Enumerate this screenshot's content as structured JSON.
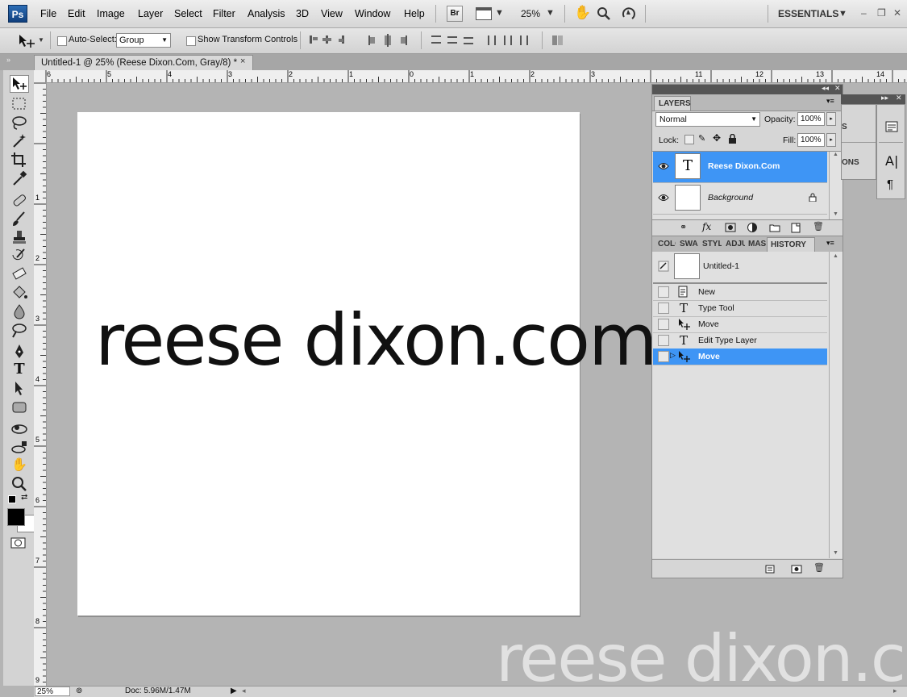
{
  "app": {
    "logo": "Ps"
  },
  "menus": [
    "File",
    "Edit",
    "Image",
    "Layer",
    "Select",
    "Filter",
    "Analysis",
    "3D",
    "View",
    "Window",
    "Help"
  ],
  "menubar": {
    "bridge_label": "Br",
    "zoom": "25%",
    "workspace": "ESSENTIALS"
  },
  "options": {
    "auto_select_label": "Auto-Select:",
    "auto_select_value": "Group",
    "transform_label": "Show Transform Controls"
  },
  "document": {
    "tab_title": "Untitled-1 @ 25% (Reese Dixon.Com, Gray/8) *",
    "close": "×"
  },
  "canvas": {
    "text": "reese dixon.com"
  },
  "watermark": {
    "text": "reese dixon.com"
  },
  "rulers": {
    "top": [
      "6",
      "5",
      "4",
      "3",
      "2",
      "1",
      "0",
      "1",
      "2",
      "3",
      "11",
      "12",
      "13",
      "14"
    ],
    "left": [
      "1",
      "2",
      "3",
      "4",
      "5",
      "6",
      "7",
      "8",
      "9"
    ]
  },
  "status": {
    "zoom": "25%",
    "doc": "Doc: 5.96M/1.47M"
  },
  "layers_panel": {
    "tab": "LAYERS",
    "blend_mode": "Normal",
    "opacity_label": "Opacity:",
    "opacity_value": "100%",
    "lock_label": "Lock:",
    "fill_label": "Fill:",
    "fill_value": "100%",
    "layers": [
      {
        "name": "Reese Dixon.Com",
        "thumb": "T",
        "selected": true
      },
      {
        "name": "Background",
        "thumb": "",
        "selected": false
      }
    ]
  },
  "history_panel": {
    "tabs": [
      "COLO",
      "SWA",
      "STYL",
      "ADJU",
      "MAS",
      "HISTORY"
    ],
    "snapshot": "Untitled-1",
    "steps": [
      {
        "label": "New",
        "icon": "new-document-icon",
        "selected": false
      },
      {
        "label": "Type Tool",
        "icon": "type-tool-icon",
        "selected": false
      },
      {
        "label": "Move",
        "icon": "move-tool-icon",
        "selected": false
      },
      {
        "label": "Edit Type Layer",
        "icon": "type-tool-icon",
        "selected": false
      },
      {
        "label": "Move",
        "icon": "move-tool-icon",
        "selected": true
      }
    ]
  },
  "dock_partial": {
    "label1": "S",
    "label2": "ONS"
  },
  "colors": {
    "accent": "#3e95f5",
    "menubar_bg": "#e2e2e2",
    "workspace_bg": "#b4b4b4"
  }
}
